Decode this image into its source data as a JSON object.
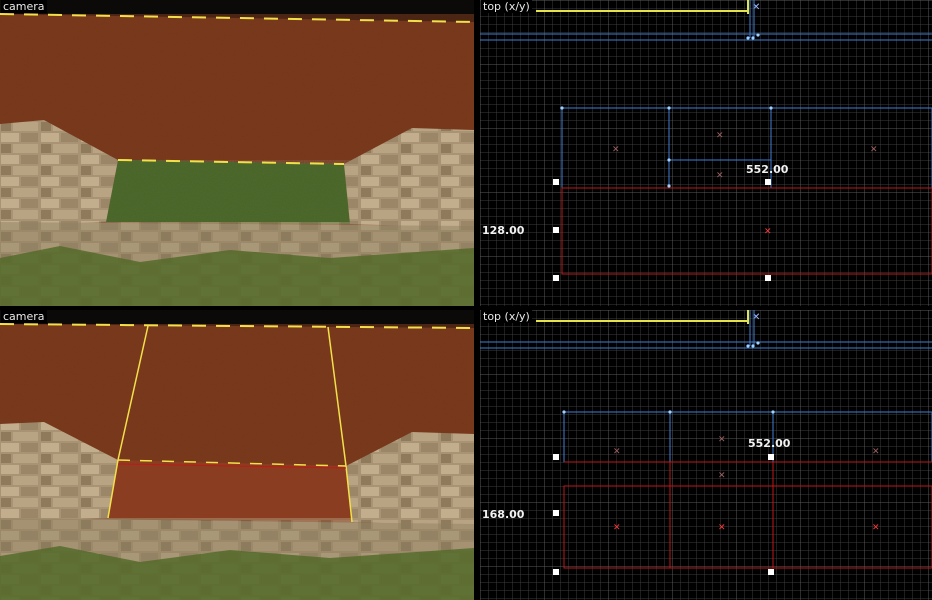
{
  "viewports": {
    "cam1": {
      "label": "camera"
    },
    "top1": {
      "label": "top (x/y)",
      "dim_width": "552.00",
      "dim_height": "128.00"
    },
    "cam2": {
      "label": "camera"
    },
    "top2": {
      "label": "top (x/y)",
      "dim_width": "552.00",
      "dim_height": "168.00"
    }
  },
  "colors": {
    "grid": "#3a3a3a",
    "brush_blue": "#3f7fd6",
    "brush_red": "#c01818",
    "selection_yellow": "#f2e04a",
    "ground": "#7a3a1c",
    "grass": "#4e6a2c",
    "stone": "#a8967a"
  }
}
